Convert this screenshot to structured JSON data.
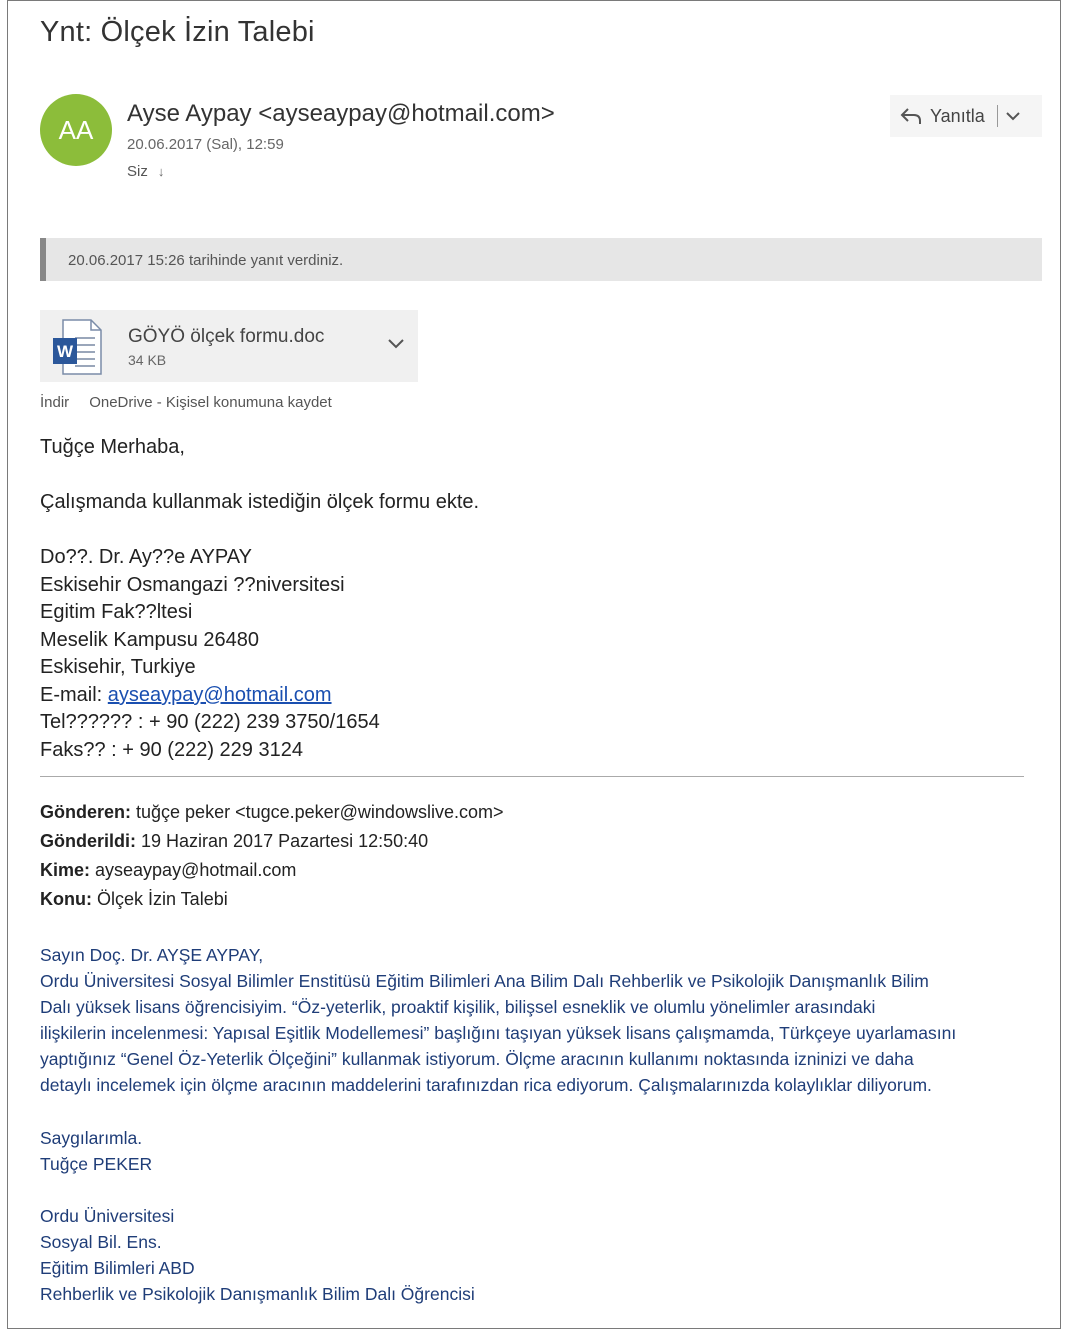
{
  "message": {
    "subject": "Ynt: Ölçek İzin Talebi",
    "avatar_initials": "AA",
    "sender": "Ayse Aypay <ayseaypay@hotmail.com>",
    "date": "20.06.2017 (Sal), 12:59",
    "to": "Siz",
    "reply_label": "Yanıtla",
    "notice": "20.06.2017 15:26 tarihinde yanıt verdiniz."
  },
  "attachment": {
    "name": "GÖYÖ ölçek formu.doc",
    "size": "34 KB",
    "download_label": "İndir",
    "onedrive_label": "OneDrive - Kişisel konumuna kaydet"
  },
  "reply_body": {
    "greeting": "Tuğçe Merhaba,",
    "line1": "Çalışmanda kullanmak istediğin ölçek formu ekte.",
    "sig_name": "Do??. Dr. Ay??e AYPAY",
    "sig_uni": "Eskisehir Osmangazi ??niversitesi",
    "sig_fac": "Egitim Fak??ltesi",
    "sig_campus": "Meselik Kampusu 26480",
    "sig_city": "Eskisehir, Turkiye",
    "email_prefix": "E-mail: ",
    "email_link": "ayseaypay@hotmail.com",
    "tel": "Tel?????? : + 90 (222) 239 3750/1654",
    "fax": "Faks?? : + 90 (222) 229 3124"
  },
  "original_header": {
    "from_label": "Gönderen:",
    "from_value": " tuğçe peker <tugce.peker@windowslive.com>",
    "sent_label": "Gönderildi:",
    "sent_value": " 19 Haziran 2017 Pazartesi 12:50:40",
    "to_label": "Kime:",
    "to_value": " ayseaypay@hotmail.com",
    "subject_label": "Konu:",
    "subject_value": " Ölçek İzin Talebi"
  },
  "original_body": {
    "salutation": "Sayın Doç. Dr. AYŞE AYPAY,",
    "p1": "Ordu Üniversitesi Sosyal Bilimler Enstitüsü Eğitim Bilimleri Ana Bilim Dalı Rehberlik ve Psikolojik Danışmanlık Bilim",
    "p2": "Dalı yüksek lisans öğrencisiyim. “Öz-yeterlik, proaktif kişilik, bilişsel esneklik ve olumlu yönelimler arasındaki",
    "p3": "ilişkilerin incelenmesi: Yapısal Eşitlik Modellemesi” başlığını taşıyan yüksek lisans çalışmamda, Türkçeye uyarlamasını",
    "p4": "yaptığınız “Genel Öz-Yeterlik Ölçeğini” kullanmak istiyorum. Ölçme aracının kullanımı noktasında izninizi ve daha",
    "p5": "detaylı incelemek için ölçme aracının maddelerini tarafınızdan rica ediyorum. Çalışmalarınızda kolaylıklar diliyorum.",
    "closing": "Saygılarımla.",
    "name": "Tuğçe PEKER",
    "inst1": "Ordu Üniversitesi",
    "inst2": "Sosyal Bil. Ens.",
    "inst3": "Eğitim Bilimleri ABD",
    "inst4": "Rehberlik ve Psikolojik Danışmanlık Bilim Dalı Öğrencisi"
  },
  "colors": {
    "avatar": "#8cbd3a",
    "link": "#1a4fb0",
    "quoted_text": "#1f3d78",
    "word_blue": "#2b579a"
  }
}
